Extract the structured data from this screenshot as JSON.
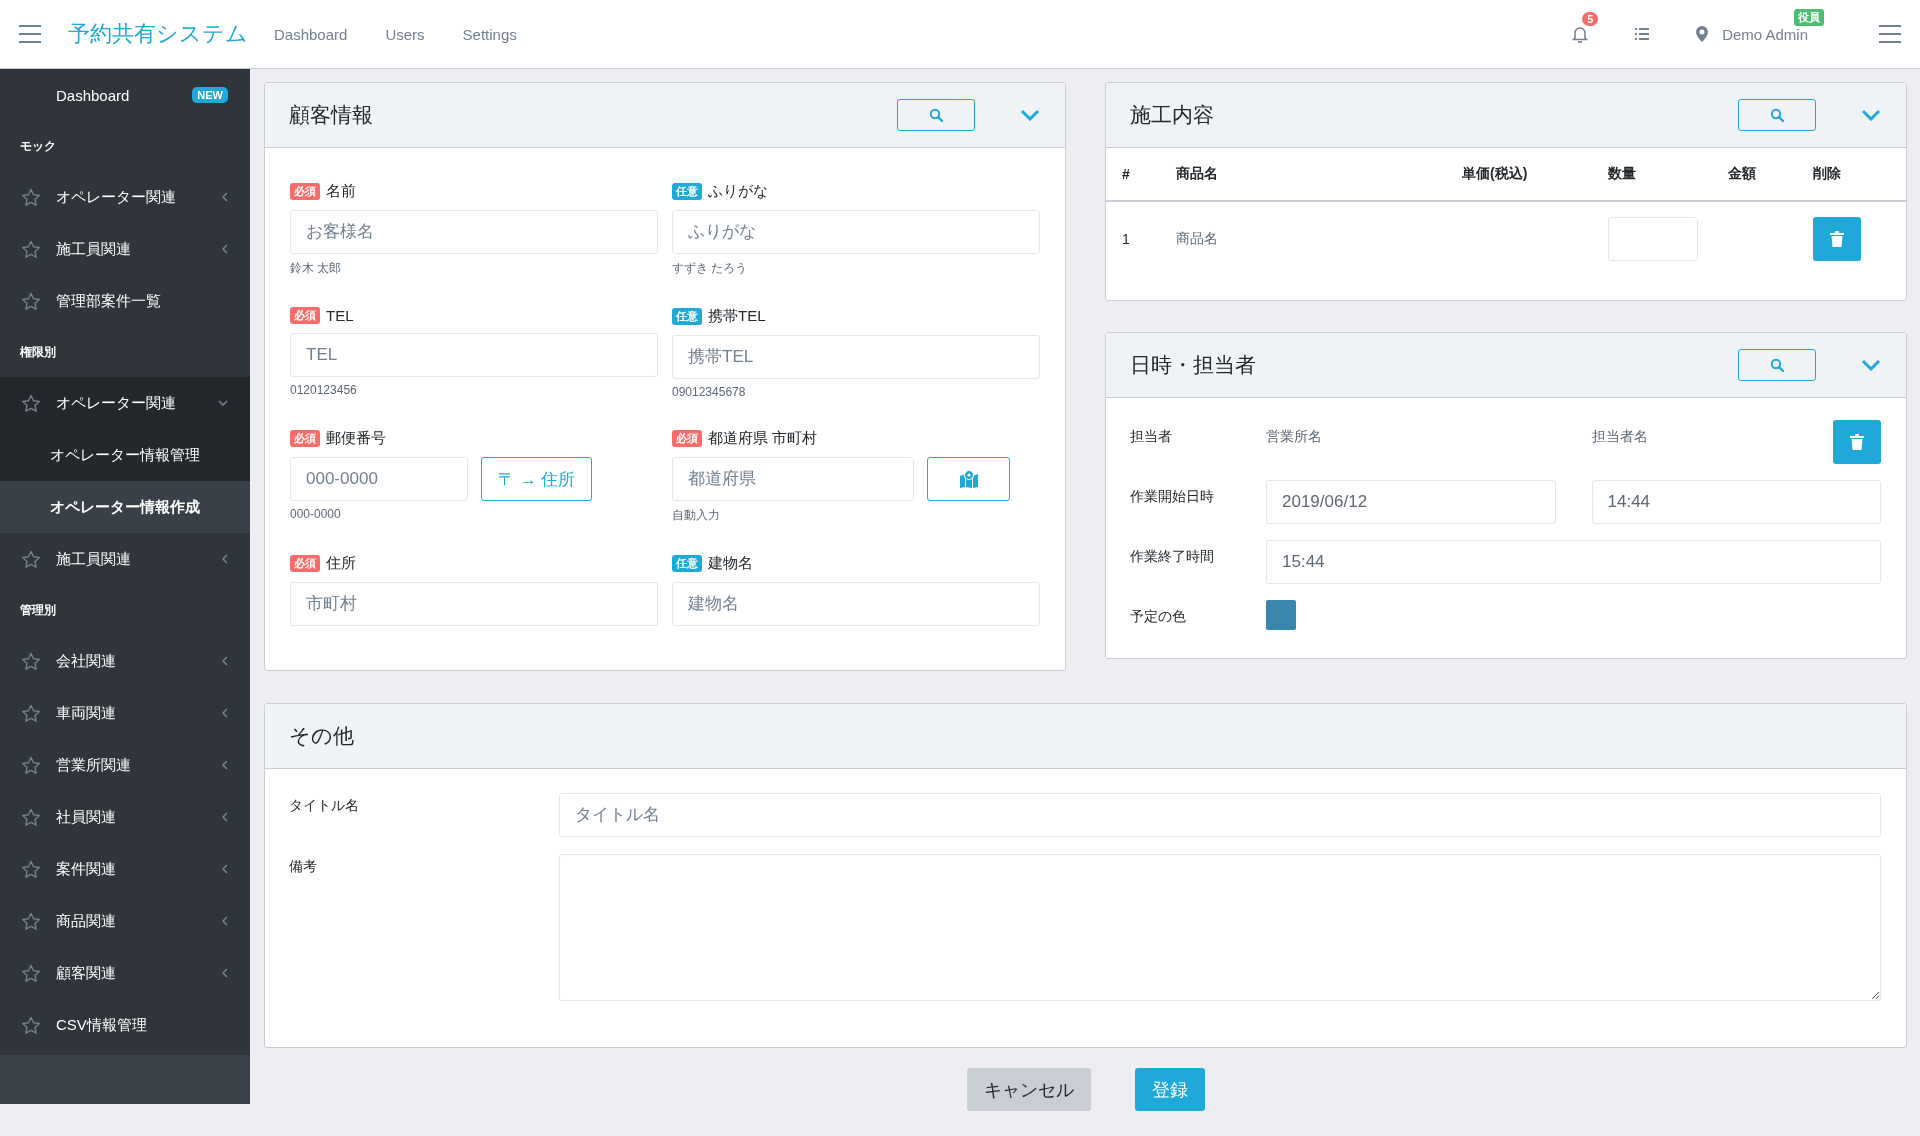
{
  "header": {
    "brand": "予約共有システム",
    "nav": [
      {
        "label": "Dashboard"
      },
      {
        "label": "Users"
      },
      {
        "label": "Settings"
      }
    ],
    "notifications": "5",
    "user": "Demo Admin",
    "role": "役員"
  },
  "sidebar": {
    "items": [
      {
        "kind": "link",
        "label": "Dashboard",
        "badge": "NEW"
      },
      {
        "kind": "section",
        "label": "モック"
      },
      {
        "kind": "group",
        "label": "オペレーター関連",
        "expanded": false
      },
      {
        "kind": "group",
        "label": "施工員関連",
        "expanded": false
      },
      {
        "kind": "item",
        "label": "管理部案件一覧"
      },
      {
        "kind": "section",
        "label": "権限別"
      },
      {
        "kind": "group",
        "label": "オペレーター関連",
        "expanded": true,
        "children": [
          {
            "label": "オペレーター情報管理",
            "selected": false
          },
          {
            "label": "オペレーター情報作成",
            "selected": true
          }
        ]
      },
      {
        "kind": "group",
        "label": "施工員関連",
        "expanded": false
      },
      {
        "kind": "section",
        "label": "管理別"
      },
      {
        "kind": "group",
        "label": "会社関連",
        "expanded": false
      },
      {
        "kind": "group",
        "label": "車両関連",
        "expanded": false
      },
      {
        "kind": "group",
        "label": "営業所関連",
        "expanded": false
      },
      {
        "kind": "group",
        "label": "社員関連",
        "expanded": false
      },
      {
        "kind": "group",
        "label": "案件関連",
        "expanded": false
      },
      {
        "kind": "group",
        "label": "商品関連",
        "expanded": false
      },
      {
        "kind": "group",
        "label": "顧客関連",
        "expanded": false
      },
      {
        "kind": "item",
        "label": "CSV情報管理"
      }
    ]
  },
  "customer": {
    "title": "顧客情報",
    "fields": [
      {
        "kind": "text",
        "tag": "必須",
        "required": true,
        "label": "名前",
        "placeholder": "お客様名",
        "hint": "鈴木 太郎"
      },
      {
        "kind": "text",
        "tag": "任意",
        "required": false,
        "label": "ふりがな",
        "placeholder": "ふりがな",
        "hint": "すずき たろう"
      },
      {
        "kind": "text",
        "tag": "必須",
        "required": true,
        "label": "TEL",
        "placeholder": "TEL",
        "hint": "0120123456"
      },
      {
        "kind": "text",
        "tag": "任意",
        "required": false,
        "label": "携帯TEL",
        "placeholder": "携帯TEL",
        "hint": "09012345678"
      },
      {
        "kind": "postal",
        "tag": "必須",
        "required": true,
        "label": "郵便番号",
        "placeholder": "000-0000",
        "hint": "000-0000",
        "button": "〒 → 住所"
      },
      {
        "kind": "map",
        "tag": "必須",
        "required": true,
        "label": "都道府県 市町村",
        "placeholder": "都道府県",
        "hint": "自動入力"
      },
      {
        "kind": "text",
        "tag": "必須",
        "required": true,
        "label": "住所",
        "placeholder": "市町村"
      },
      {
        "kind": "text",
        "tag": "任意",
        "required": false,
        "label": "建物名",
        "placeholder": "建物名"
      }
    ]
  },
  "work": {
    "title": "施工内容",
    "columns": [
      "#",
      "商品名",
      "単価(税込)",
      "数量",
      "金額",
      "削除"
    ],
    "rows": [
      {
        "number": "1",
        "name": "商品名"
      }
    ]
  },
  "schedule": {
    "title": "日時・担当者",
    "staff": {
      "label": "担当者",
      "office": "営業所名",
      "person": "担当者名"
    },
    "start": {
      "label": "作業開始日時",
      "date": "2019/06/12",
      "time": "14:44"
    },
    "end": {
      "label": "作業終了時間",
      "time": "15:44"
    },
    "color": {
      "label": "予定の色",
      "color": "#3a87ad"
    }
  },
  "other": {
    "title": "その他",
    "title_field": {
      "label": "タイトル名",
      "placeholder": "タイトル名"
    },
    "notes": {
      "label": "備考"
    }
  },
  "actions": [
    {
      "kind": "cancel",
      "label": "キャンセル"
    },
    {
      "kind": "submit",
      "label": "登録"
    }
  ]
}
